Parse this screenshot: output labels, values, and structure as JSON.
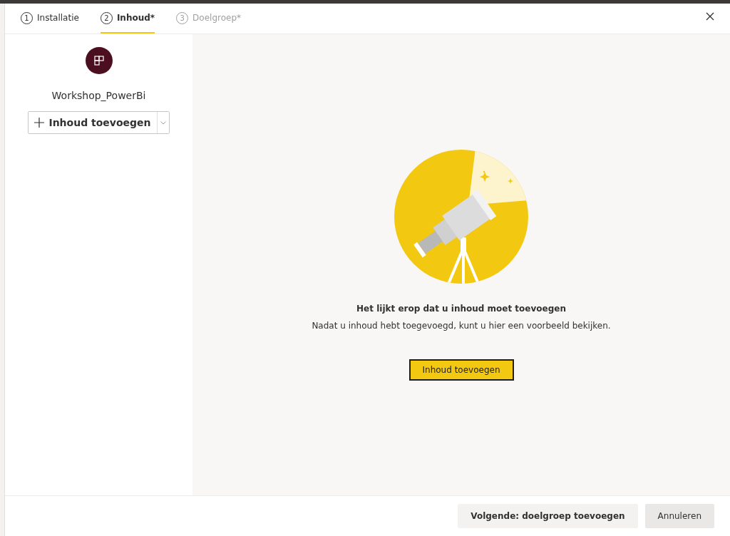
{
  "steps": [
    {
      "number": "1",
      "label": "Installatie",
      "selected": false,
      "disabled": false
    },
    {
      "number": "2",
      "label": "Inhoud*",
      "selected": true,
      "disabled": false
    },
    {
      "number": "3",
      "label": "Doelgroep*",
      "selected": false,
      "disabled": true
    }
  ],
  "sidebar": {
    "workspace_name": "Workshop_PowerBi",
    "add_button": "Inhoud toevoegen"
  },
  "empty_state": {
    "title": "Het lijkt erop dat u inhoud moet toevoegen",
    "description": "Nadat u inhoud hebt toegevoegd, kunt u hier een voorbeeld bekijken.",
    "button": "Inhoud toevoegen"
  },
  "footer": {
    "buttons": [
      "Volgende: doelgroep toevoegen",
      "Annuleren"
    ]
  }
}
